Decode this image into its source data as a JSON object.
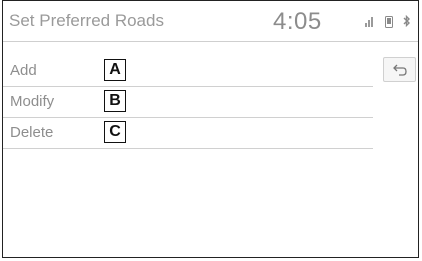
{
  "header": {
    "title": "Set Preferred Roads",
    "clock": "4:05",
    "status_icons": [
      "signal-strength-icon",
      "phone-icon",
      "bluetooth-icon"
    ]
  },
  "menu": {
    "items": [
      {
        "label": "Add",
        "callout": "A"
      },
      {
        "label": "Modify",
        "callout": "B"
      },
      {
        "label": "Delete",
        "callout": "C"
      }
    ]
  },
  "back_button": {
    "icon": "back-arrow-icon"
  }
}
